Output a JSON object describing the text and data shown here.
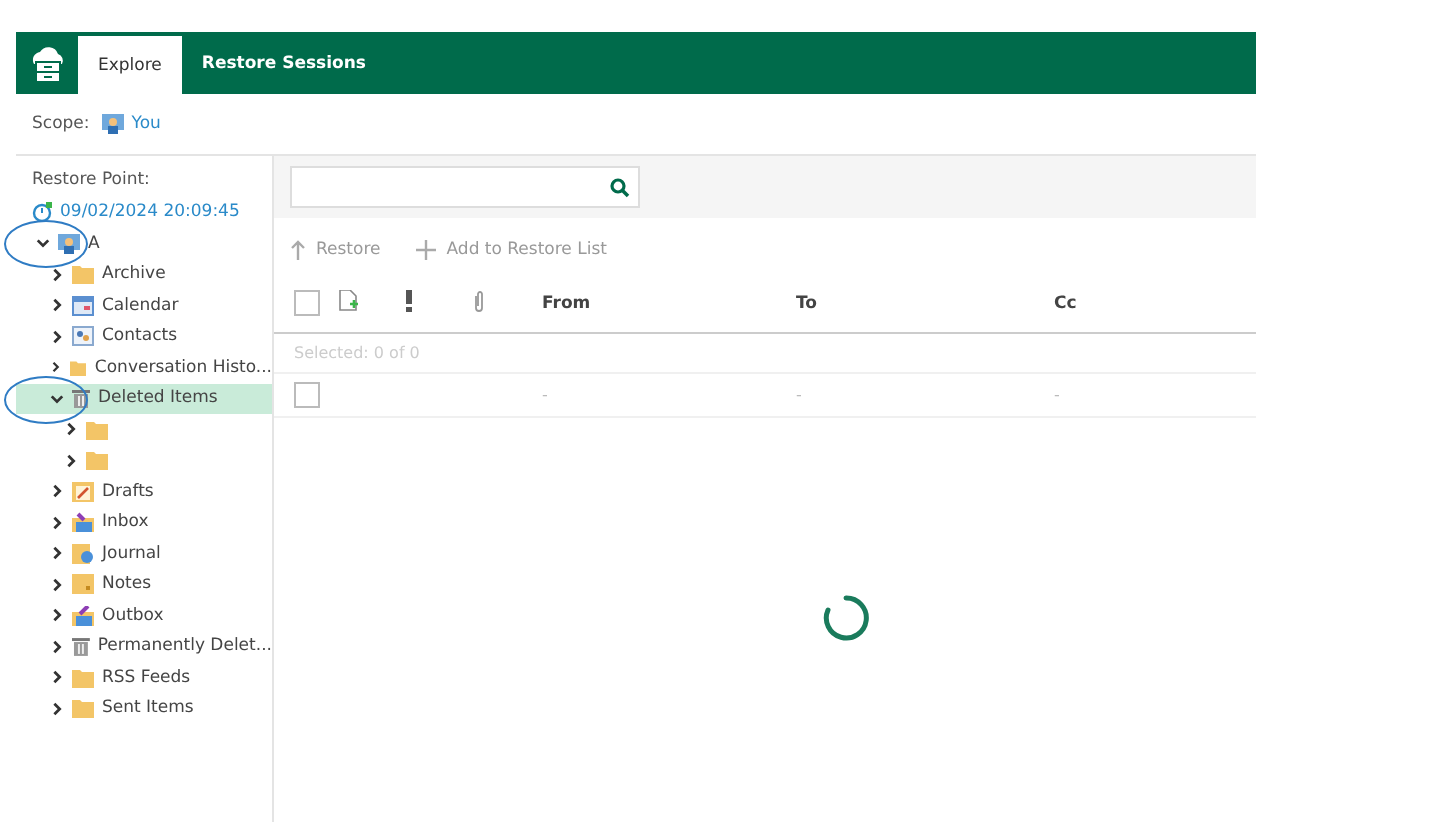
{
  "header": {
    "tabs": [
      {
        "label": "Explore",
        "selected": true
      },
      {
        "label": "Restore Sessions",
        "selected": false
      }
    ]
  },
  "scope": {
    "label": "Scope:",
    "value": "You"
  },
  "restore_point": {
    "label": "Restore Point:",
    "value": "09/02/2024 20:09:45"
  },
  "tree": [
    {
      "label": "A",
      "kind": "mailbox",
      "expanded": true,
      "selected": false,
      "annotated": true,
      "children": [
        {
          "label": "Archive",
          "kind": "folder",
          "expanded": false,
          "selected": false,
          "annotated": false
        },
        {
          "label": "Calendar",
          "kind": "calendar",
          "expanded": false,
          "selected": false,
          "annotated": false
        },
        {
          "label": "Contacts",
          "kind": "contacts",
          "expanded": false,
          "selected": false,
          "annotated": false
        },
        {
          "label": "Conversation Histo...",
          "kind": "folder",
          "expanded": false,
          "selected": false,
          "annotated": false
        },
        {
          "label": "Deleted Items",
          "kind": "trash",
          "expanded": true,
          "selected": true,
          "annotated": true,
          "children": [
            {
              "kind": "folder",
              "expanded": false,
              "selected": false,
              "annotated": false
            },
            {
              "kind": "folder",
              "expanded": false,
              "selected": false,
              "annotated": false
            }
          ]
        },
        {
          "label": "Drafts",
          "kind": "drafts",
          "expanded": false,
          "selected": false,
          "annotated": false
        },
        {
          "label": "Inbox",
          "kind": "inbox",
          "expanded": false,
          "selected": false,
          "annotated": false
        },
        {
          "label": "Journal",
          "kind": "journal",
          "expanded": false,
          "selected": false,
          "annotated": false
        },
        {
          "label": "Notes",
          "kind": "notes",
          "expanded": false,
          "selected": false,
          "annotated": false
        },
        {
          "label": "Outbox",
          "kind": "outbox",
          "expanded": false,
          "selected": false,
          "annotated": false
        },
        {
          "label": "Permanently Delet...",
          "kind": "trash",
          "expanded": false,
          "selected": false,
          "annotated": false
        },
        {
          "label": "RSS Feeds",
          "kind": "folder",
          "expanded": false,
          "selected": false,
          "annotated": false
        },
        {
          "label": "Sent Items",
          "kind": "folder",
          "expanded": false,
          "selected": false,
          "annotated": false
        }
      ]
    }
  ],
  "toolbar": [
    {
      "label": "Restore",
      "kind": "up"
    },
    {
      "label": "Add to Restore List",
      "kind": "plus"
    }
  ],
  "table": {
    "select_all_checked": false,
    "columns": [
      "From",
      "To",
      "Cc"
    ],
    "selected_info": "Selected: 0 of 0",
    "rows": [
      {
        "checked": false,
        "cells": [
          "-",
          "-",
          "-"
        ]
      }
    ]
  },
  "loading": true
}
